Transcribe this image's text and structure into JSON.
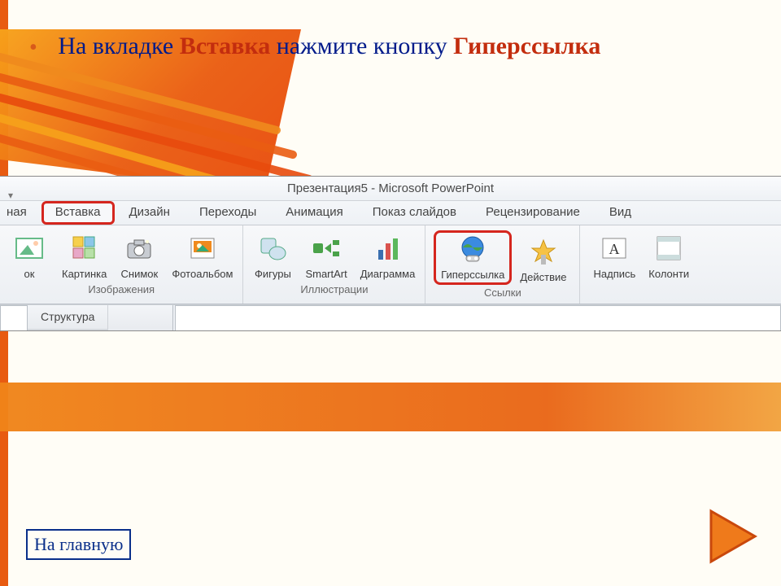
{
  "instruction": {
    "pre": "На вкладке ",
    "kw1": "Вставка",
    "mid": " нажмите кнопку ",
    "kw2": "Гиперссылка"
  },
  "titlebar": "Презентация5 - Microsoft PowerPoint",
  "qat": "▾",
  "tabs": {
    "t0": "ная",
    "t1": "Вставка",
    "t2": "Дизайн",
    "t3": "Переходы",
    "t4": "Анимация",
    "t5": "Показ слайдов",
    "t6": "Рецензирование",
    "t7": "Вид"
  },
  "ribbon": {
    "images": {
      "title": "Изображения",
      "b0": "ок",
      "b1": "Картинка",
      "b2": "Снимок",
      "b3": "Фотоальбом"
    },
    "illustr": {
      "title": "Иллюстрации",
      "b1": "Фигуры",
      "b2": "SmartArt",
      "b3": "Диаграмма"
    },
    "links": {
      "title": "Ссылки",
      "b1": "Гиперссылка",
      "b2": "Действие"
    },
    "text": {
      "b1": "Надпись",
      "b2": "Колонти"
    }
  },
  "panel": {
    "tab1": "Структура"
  },
  "home_link": "На главную"
}
